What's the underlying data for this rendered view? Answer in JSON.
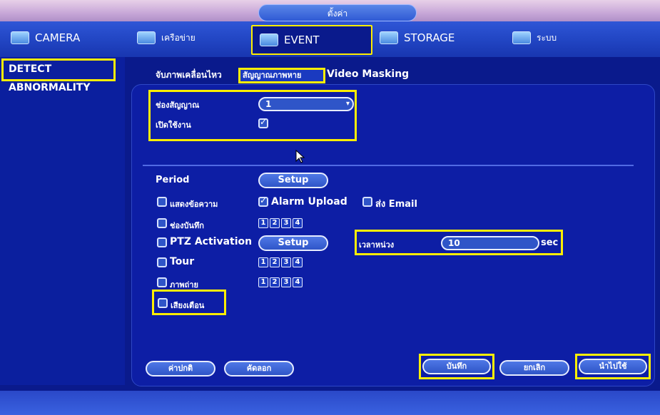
{
  "window": {
    "title": "ตั้งค่า"
  },
  "nav": {
    "tabs": [
      {
        "label": "CAMERA"
      },
      {
        "label": "เครือข่าย"
      },
      {
        "label": "EVENT"
      },
      {
        "label": "STORAGE"
      },
      {
        "label": "ระบบ"
      }
    ],
    "active": "EVENT"
  },
  "sidebar": {
    "items": [
      {
        "label": "DETECT"
      },
      {
        "label": "ABNORMALITY"
      }
    ],
    "active": "DETECT"
  },
  "subtabs": [
    {
      "label": "จับภาพเคลื่อนไหว"
    },
    {
      "label": "สัญญาณภาพหาย"
    },
    {
      "label": "Video Masking"
    }
  ],
  "form": {
    "channel_label": "ช่องสัญญาณ",
    "channel_value": "1",
    "enable_label": "เปิดใช้งาน",
    "enable_checked": true,
    "period_label": "Period",
    "setup_label": "Setup",
    "show_message_label": "แสดงข้อความ",
    "alarm_upload_label": "Alarm Upload",
    "send_email_label": "ส่ง Email",
    "record_channel_label": "ช่องบันทึก",
    "ptz_label": "PTZ Activation",
    "ptz_setup_label": "Setup",
    "delay_label": "เวลาหน่วง",
    "delay_value": "10",
    "delay_unit": "sec",
    "tour_label": "Tour",
    "snapshot_label": "ภาพถ่าย",
    "buzzer_label": "เสียงเตือน",
    "channel_numbers": [
      "1",
      "2",
      "3",
      "4"
    ]
  },
  "buttons": {
    "default": "ค่าปกติ",
    "copy": "คัดลอก",
    "save": "บันทึก",
    "cancel": "ยกเลิก",
    "apply": "นำไปใช้"
  },
  "colors": {
    "highlight": "#ffee00",
    "background": "#0a1a8c"
  }
}
